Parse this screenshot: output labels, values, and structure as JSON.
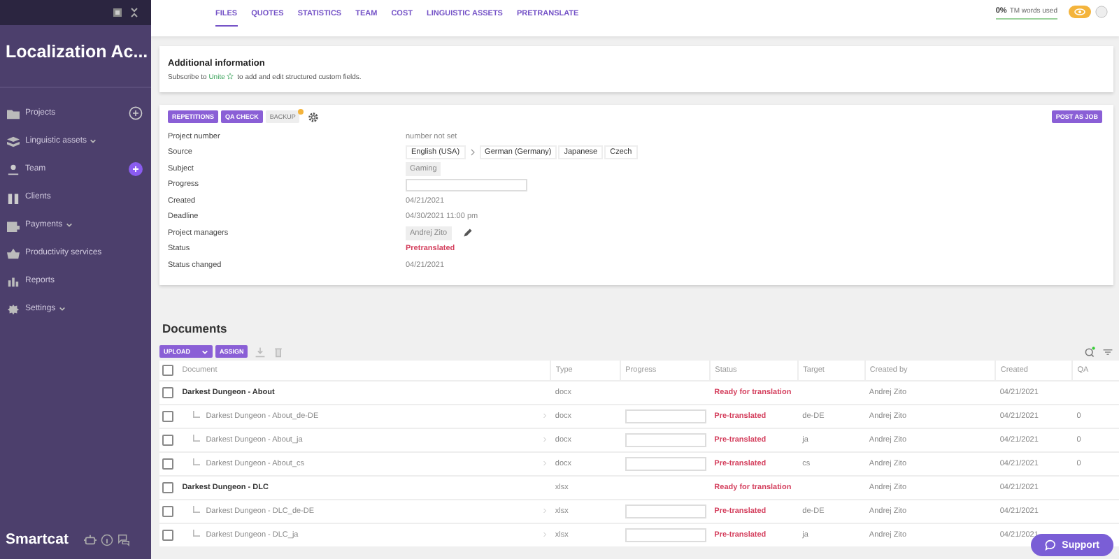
{
  "sidebar": {
    "title": "Localization Ac...",
    "items": [
      {
        "label": "Projects",
        "dropdown": false,
        "kind": "add"
      },
      {
        "label": "Linguistic assets",
        "dropdown": true,
        "kind": "plain"
      },
      {
        "label": "Team",
        "dropdown": false,
        "kind": "invite"
      },
      {
        "label": "Clients",
        "dropdown": false,
        "kind": "plain"
      },
      {
        "label": "Payments",
        "dropdown": true,
        "kind": "plain"
      },
      {
        "label": "Productivity services",
        "dropdown": false,
        "kind": "plain"
      },
      {
        "label": "Reports",
        "dropdown": false,
        "kind": "plain"
      },
      {
        "label": "Settings",
        "dropdown": true,
        "kind": "plain"
      }
    ],
    "logo": "Smartcat"
  },
  "tabs": [
    {
      "label": "FILES",
      "selected": true
    },
    {
      "label": "QUOTES",
      "selected": false
    },
    {
      "label": "STATISTICS",
      "selected": false
    },
    {
      "label": "TEAM",
      "selected": false
    },
    {
      "label": "COST",
      "selected": false
    },
    {
      "label": "LINGUISTIC ASSETS",
      "selected": false
    },
    {
      "label": "PRETRANSLATE",
      "selected": false
    }
  ],
  "usage": {
    "percent": "0%",
    "label": "TM words used"
  },
  "additional_info": {
    "title": "Additional information",
    "before": "Subscribe to ",
    "link": "Unite",
    "after": " to add and edit structured custom fields."
  },
  "project": {
    "buttons": [
      {
        "label": "REPETITIONS",
        "kind": "primary"
      },
      {
        "label": "QA CHECK",
        "kind": "primary"
      },
      {
        "label": "BACKUP",
        "kind": "plain"
      }
    ],
    "post_button": "POST AS JOB",
    "fields": [
      {
        "label": "Project number",
        "kind": "muted",
        "value": "number not set"
      },
      {
        "label": "Source",
        "kind": "languages",
        "source": "English (USA)",
        "targets": [
          "German (Germany)",
          "Japanese",
          "Czech"
        ]
      },
      {
        "label": "Subject",
        "kind": "tag",
        "value": "Gaming"
      },
      {
        "label": "Progress",
        "kind": "progress",
        "level": 0
      },
      {
        "label": "Created",
        "kind": "muted",
        "value": "04/21/2021"
      },
      {
        "label": "Deadline",
        "kind": "muted",
        "value": "04/30/2021 11:00 pm"
      },
      {
        "label": "Project managers",
        "kind": "manager",
        "value": "Andrej Zito"
      },
      {
        "label": "Status",
        "kind": "status",
        "value": "Pretranslated"
      },
      {
        "label": "Status changed",
        "kind": "muted",
        "value": "04/21/2021"
      }
    ]
  },
  "documents": {
    "title": "Documents",
    "upload": "UPLOAD",
    "assign": "ASSIGN",
    "columns": [
      "Document",
      "Type",
      "Progress",
      "Status",
      "Target",
      "Created by",
      "Created",
      "QA"
    ],
    "header_checked": false,
    "rows": [
      {
        "kind": "file",
        "checked": false,
        "name": "Darkest Dungeon - About",
        "type": "docx",
        "status": "Ready for translation",
        "created_by": "Andrej Zito",
        "created": "04/21/2021"
      },
      {
        "kind": "target",
        "checked": false,
        "name": "Darkest Dungeon - About_de-DE",
        "type": "docx",
        "level": 0,
        "status": "Pre-translated",
        "target": "de-DE",
        "created_by": "Andrej Zito",
        "created": "04/21/2021",
        "qa": "0"
      },
      {
        "kind": "target",
        "checked": false,
        "name": "Darkest Dungeon - About_ja",
        "type": "docx",
        "level": 0,
        "status": "Pre-translated",
        "target": "ja",
        "created_by": "Andrej Zito",
        "created": "04/21/2021",
        "qa": "0"
      },
      {
        "kind": "target",
        "checked": false,
        "name": "Darkest Dungeon - About_cs",
        "type": "docx",
        "level": 0,
        "status": "Pre-translated",
        "target": "cs",
        "created_by": "Andrej Zito",
        "created": "04/21/2021",
        "qa": "0"
      },
      {
        "kind": "file",
        "checked": false,
        "name": "Darkest Dungeon - DLC",
        "type": "xlsx",
        "status": "Ready for translation",
        "created_by": "Andrej Zito",
        "created": "04/21/2021"
      },
      {
        "kind": "target",
        "checked": false,
        "name": "Darkest Dungeon - DLC_de-DE",
        "type": "xlsx",
        "level": 0,
        "status": "Pre-translated",
        "target": "de-DE",
        "created_by": "Andrej Zito",
        "created": "04/21/2021"
      },
      {
        "kind": "target",
        "checked": false,
        "name": "Darkest Dungeon - DLC_ja",
        "type": "xlsx",
        "level": 0,
        "status": "Pre-translated",
        "target": "ja",
        "created_by": "Andrej Zito",
        "created": "04/21/2021"
      }
    ]
  },
  "support": "Support"
}
